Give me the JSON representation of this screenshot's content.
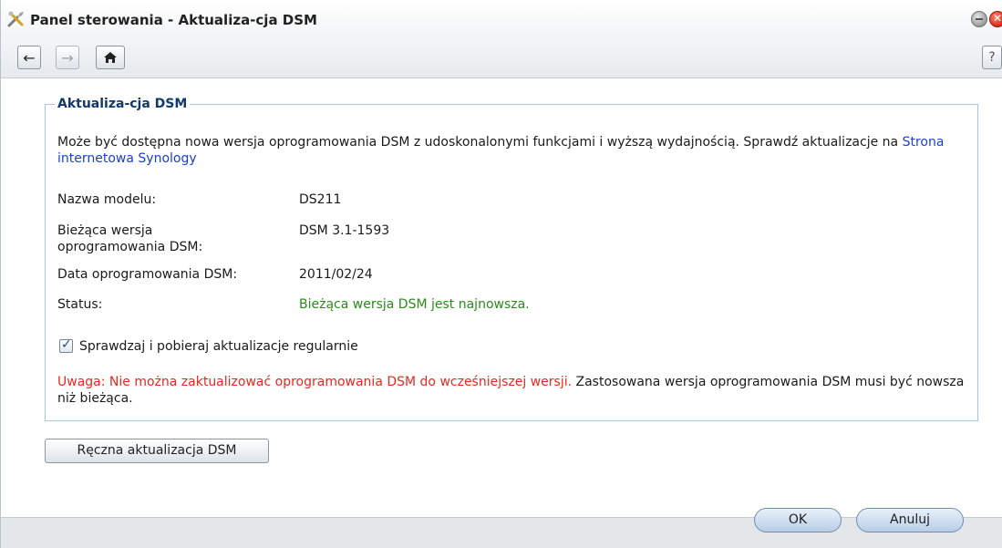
{
  "window": {
    "title": "Panel sterowania - Aktualiza-cja DSM",
    "icon": "tools-icon"
  },
  "toolbar": {
    "back_icon": "arrow-left-icon",
    "forward_icon": "arrow-right-icon",
    "home_icon": "home-icon",
    "help_label": "?"
  },
  "group": {
    "legend": "Aktualiza-cja DSM",
    "description": "Może być dostępna nowa wersja oprogramowania DSM z udoskonalonymi funkcjami i wyższą wydajnością. Sprawdź aktualizacje na ",
    "link_text": "Strona internetowa Synology",
    "fields": {
      "model_label": "Nazwa modelu:",
      "model_value": "DS211",
      "version_label": "Bieżąca wersja oprogramowania DSM:",
      "version_value": "DSM 3.1-1593",
      "date_label": "Data oprogramowania DSM:",
      "date_value": "2011/02/24",
      "status_label": "Status:",
      "status_value": "Bieżąca wersja DSM jest najnowsza."
    },
    "auto_update": {
      "label": "Sprawdzaj i pobieraj aktualizacje regularnie",
      "checked": true
    },
    "warning_red": "Uwaga: Nie można zaktualizować oprogramowania DSM do wcześniejszej wersji.",
    "warning_rest": " Zastosowana wersja oprogramowania DSM musi być nowsza niż bieżąca."
  },
  "buttons": {
    "manual_update": "Ręczna aktualizacja DSM",
    "ok": "OK",
    "cancel": "Anuluj"
  },
  "colors": {
    "link": "#1a3fd6",
    "status_ok": "#2a8a1a",
    "warning": "#e8281e",
    "legend": "#12396b"
  }
}
